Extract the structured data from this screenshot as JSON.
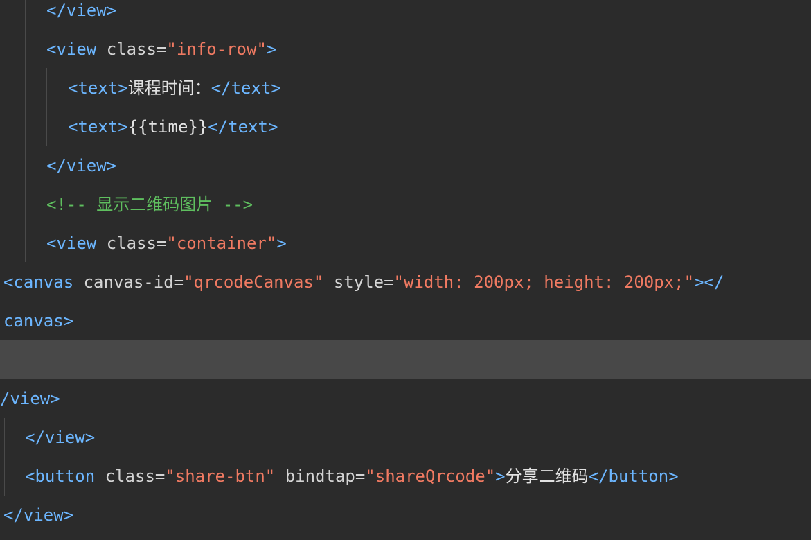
{
  "editor": {
    "lines": [
      {
        "segments": [
          {
            "t": "</view>",
            "c": "tag"
          }
        ]
      },
      {
        "segments": [
          {
            "t": "<view ",
            "c": "tag"
          },
          {
            "t": "class=",
            "c": "attr"
          },
          {
            "t": "\"info-row\"",
            "c": "str"
          },
          {
            "t": ">",
            "c": "tag"
          }
        ]
      },
      {
        "segments": [
          {
            "t": "<text>",
            "c": "tag"
          },
          {
            "t": "课程时间：",
            "c": "txt cjk"
          },
          {
            "t": "</text>",
            "c": "tag"
          }
        ]
      },
      {
        "segments": [
          {
            "t": "<text>",
            "c": "tag"
          },
          {
            "t": "{{time}}",
            "c": "txt"
          },
          {
            "t": "</text>",
            "c": "tag"
          }
        ]
      },
      {
        "segments": [
          {
            "t": "</view>",
            "c": "tag"
          }
        ]
      },
      {
        "segments": [
          {
            "t": "<!-- ",
            "c": "comment"
          },
          {
            "t": "显示二维码图片",
            "c": "comment cjk"
          },
          {
            "t": " -->",
            "c": "comment"
          }
        ]
      },
      {
        "segments": [
          {
            "t": "<view ",
            "c": "tag"
          },
          {
            "t": "class=",
            "c": "attr"
          },
          {
            "t": "\"container\"",
            "c": "str"
          },
          {
            "t": ">",
            "c": "tag"
          }
        ]
      },
      {
        "segments": [
          {
            "t": "<canvas ",
            "c": "tag"
          },
          {
            "t": "canvas-id=",
            "c": "attr"
          },
          {
            "t": "\"qrcodeCanvas\"",
            "c": "str"
          },
          {
            "t": " style=",
            "c": "attr"
          },
          {
            "t": "\"width: 200px; height: 200px;\"",
            "c": "str"
          },
          {
            "t": "></",
            "c": "tag"
          }
        ]
      },
      {
        "segments": [
          {
            "t": "canvas>",
            "c": "tag"
          }
        ]
      },
      {
        "segments": []
      },
      {
        "segments": [
          {
            "t": "/view>",
            "c": "tag"
          }
        ]
      },
      {
        "segments": [
          {
            "t": "</view>",
            "c": "tag"
          }
        ]
      },
      {
        "segments": [
          {
            "t": "<button ",
            "c": "tag"
          },
          {
            "t": "class=",
            "c": "attr"
          },
          {
            "t": "\"share-btn\"",
            "c": "str"
          },
          {
            "t": " bindtap=",
            "c": "attr"
          },
          {
            "t": "\"shareQrcode\"",
            "c": "str"
          },
          {
            "t": ">",
            "c": "tag"
          },
          {
            "t": "分享二维码",
            "c": "txt cjk"
          },
          {
            "t": "</button>",
            "c": "tag"
          }
        ]
      },
      {
        "segments": [
          {
            "t": "</view>",
            "c": "tag"
          }
        ]
      }
    ]
  },
  "colors": {
    "background": "#2b2b2b",
    "current_line": "#484848",
    "tag": "#6cb6ff",
    "attribute": "#d4d4d4",
    "string": "#f07a62",
    "text": "#e2e2e2",
    "comment": "#5fbf5f"
  }
}
